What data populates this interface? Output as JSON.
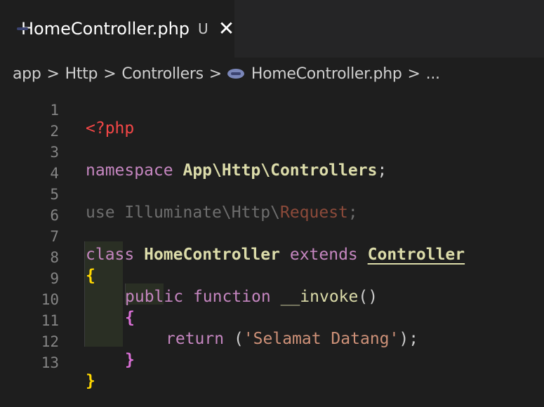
{
  "tab": {
    "icon": "php-file-icon",
    "filename": "HomeController.php",
    "status": "U",
    "close": "✕"
  },
  "breadcrumb": {
    "parts": [
      "app",
      "Http",
      "Controllers",
      "HomeController.php",
      "..."
    ],
    "separator": ">"
  },
  "editor": {
    "lines": [
      {
        "num": "1"
      },
      {
        "num": "2"
      },
      {
        "num": "3"
      },
      {
        "num": "4"
      },
      {
        "num": "5"
      },
      {
        "num": "6"
      },
      {
        "num": "7"
      },
      {
        "num": "8"
      },
      {
        "num": "9"
      },
      {
        "num": "10"
      },
      {
        "num": "11"
      },
      {
        "num": "12"
      },
      {
        "num": "13"
      }
    ],
    "tokens": {
      "php_open": "<?php",
      "namespace_kw": "namespace",
      "namespace_name": "App\\Http\\Controllers",
      "semicolon": ";",
      "use_kw": "use",
      "use_path": "Illuminate\\Http\\",
      "use_class": "Request",
      "class_kw": "class",
      "class_name": "HomeController",
      "extends_kw": "extends",
      "parent_class": "Controller",
      "open_brace": "{",
      "close_brace": "}",
      "public_kw": "public",
      "function_kw": "function",
      "method_name": "__invoke",
      "parens": "()",
      "return_kw": "return",
      "open_paren": "(",
      "string": "'Selamat Datang'",
      "close_paren_semi": ");"
    }
  },
  "colors": {
    "background": "#1e1e1e",
    "tabbar": "#252526",
    "keyword": "#c586c0",
    "class": "#dcdcaa",
    "string": "#ce9178",
    "brace": "#ffd700",
    "line_number": "#858585"
  }
}
